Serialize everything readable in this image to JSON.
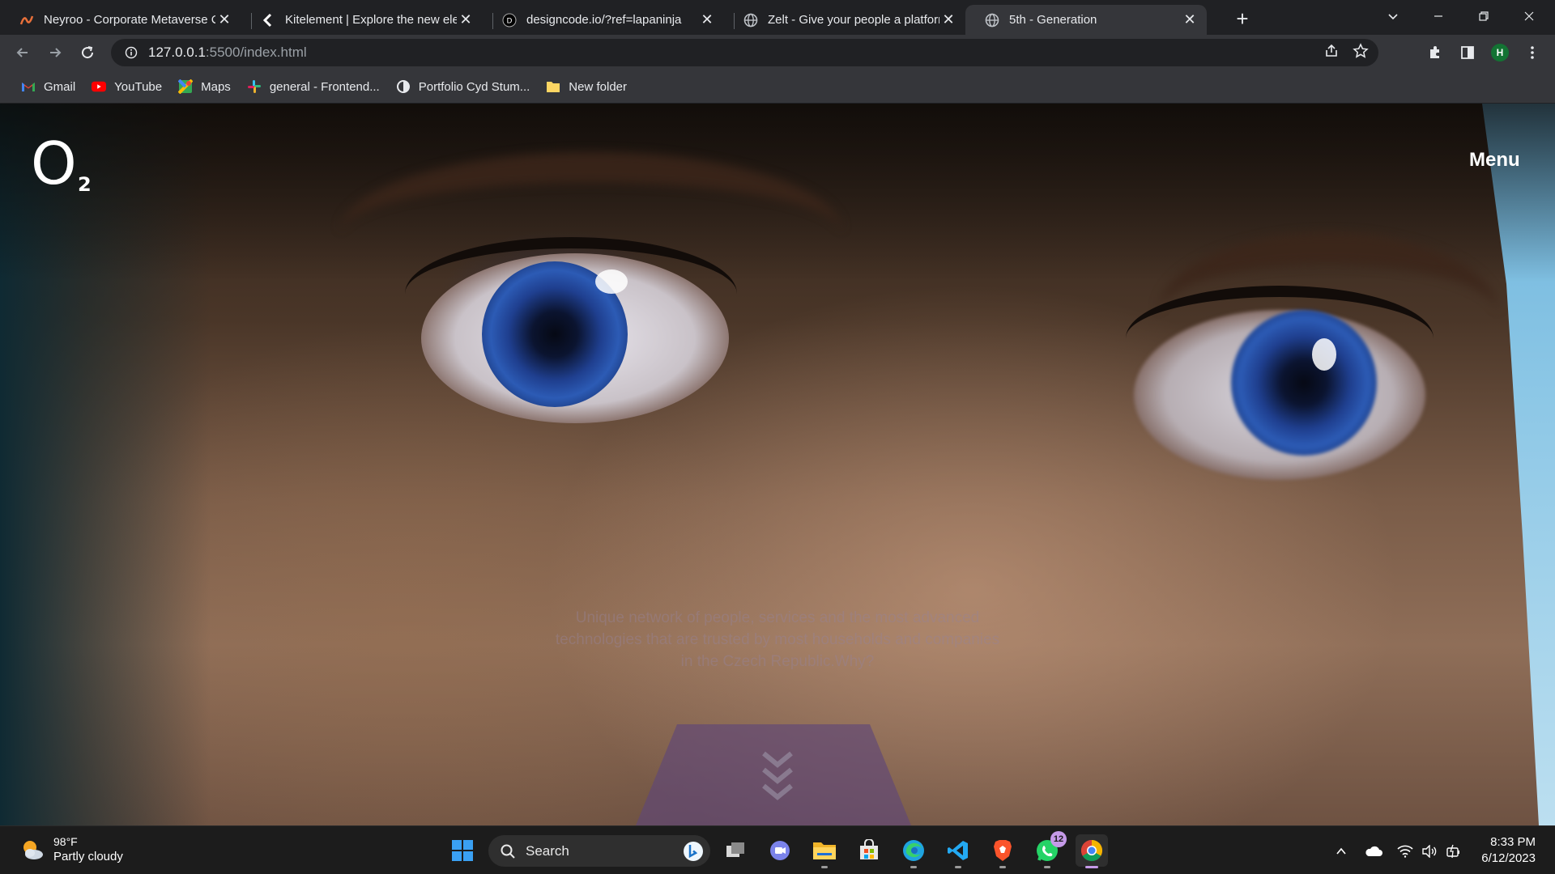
{
  "browser": {
    "tabs": [
      {
        "title": "Neyroo - Corporate Metaverse C",
        "icon": "neyroo-icon",
        "active": false
      },
      {
        "title": "Kitelement | Explore the new elem",
        "icon": "kitelement-icon",
        "active": false
      },
      {
        "title": "designcode.io/?ref=lapaninja",
        "icon": "designcode-icon",
        "active": false
      },
      {
        "title": "Zelt - Give your people a platform",
        "icon": "globe-icon",
        "active": false
      },
      {
        "title": "5th - Generation",
        "icon": "globe-icon",
        "active": true
      }
    ],
    "url_host": "127.0.0.1",
    "url_path": ":5500/index.html",
    "profile_initial": "H",
    "bookmarks": [
      {
        "label": "Gmail",
        "icon": "gmail-icon"
      },
      {
        "label": "YouTube",
        "icon": "youtube-icon"
      },
      {
        "label": "Maps",
        "icon": "maps-icon"
      },
      {
        "label": "general - Frontend...",
        "icon": "slack-icon"
      },
      {
        "label": "Portfolio Cyd Stum...",
        "icon": "portfolio-icon"
      },
      {
        "label": "New folder",
        "icon": "folder-icon"
      }
    ]
  },
  "site": {
    "logo_letter": "O",
    "logo_subscript": "2",
    "menu_label": "Menu",
    "intro_text": "Unique network of people, services and the most advanced technologies that are trusted by most households and companies in the Czech Republic.Why?"
  },
  "taskbar": {
    "weather_temp": "98°F",
    "weather_condition": "Partly cloudy",
    "search_label": "Search",
    "whatsapp_badge": "12",
    "time": "8:33 PM",
    "date": "6/12/2023"
  },
  "colors": {
    "tabstrip_bg": "#202124",
    "toolbar_bg": "#35363a",
    "taskbar_bg": "#1c1c1c",
    "scroll_tab": "#5f4678",
    "active_indicator": "#c59ae8"
  }
}
